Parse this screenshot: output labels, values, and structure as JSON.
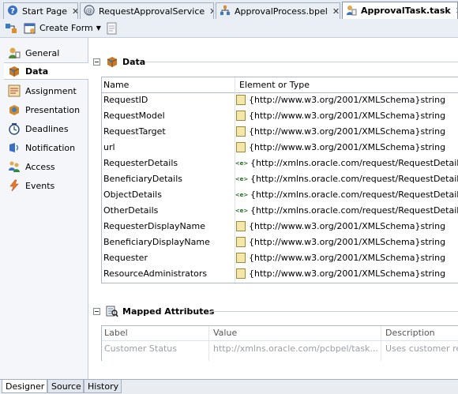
{
  "tabs": [
    {
      "label": "Start Page"
    },
    {
      "label": "RequestApprovalService"
    },
    {
      "label": "ApprovalProcess.bpel"
    },
    {
      "label": "ApprovalTask.task"
    }
  ],
  "toolbar": {
    "create_form_label": "Create Form"
  },
  "nav": [
    {
      "label": "General"
    },
    {
      "label": "Data"
    },
    {
      "label": "Assignment"
    },
    {
      "label": "Presentation"
    },
    {
      "label": "Deadlines"
    },
    {
      "label": "Notification"
    },
    {
      "label": "Access"
    },
    {
      "label": "Events"
    }
  ],
  "data_section": {
    "title": "Data",
    "columns": [
      "Name",
      "Element or Type"
    ],
    "rows": [
      {
        "name": "RequestID",
        "type": "{http://www.w3.org/2001/XMLSchema}string",
        "kind": "type"
      },
      {
        "name": "RequestModel",
        "type": "{http://www.w3.org/2001/XMLSchema}string",
        "kind": "type"
      },
      {
        "name": "RequestTarget",
        "type": "{http://www.w3.org/2001/XMLSchema}string",
        "kind": "type"
      },
      {
        "name": "url",
        "type": "{http://www.w3.org/2001/XMLSchema}string",
        "kind": "type"
      },
      {
        "name": "RequesterDetails",
        "type": "{http://xmlns.oracle.com/request/RequestDetail",
        "kind": "element"
      },
      {
        "name": "BeneficiaryDetails",
        "type": "{http://xmlns.oracle.com/request/RequestDetail",
        "kind": "element"
      },
      {
        "name": "ObjectDetails",
        "type": "{http://xmlns.oracle.com/request/RequestDetail",
        "kind": "element"
      },
      {
        "name": "OtherDetails",
        "type": "{http://xmlns.oracle.com/request/RequestDetail",
        "kind": "element"
      },
      {
        "name": "RequesterDisplayName",
        "type": "{http://www.w3.org/2001/XMLSchema}string",
        "kind": "type"
      },
      {
        "name": "BeneficiaryDisplayName",
        "type": "{http://www.w3.org/2001/XMLSchema}string",
        "kind": "type"
      },
      {
        "name": "Requester",
        "type": "{http://www.w3.org/2001/XMLSchema}string",
        "kind": "type"
      },
      {
        "name": "ResourceAdministrators",
        "type": "{http://www.w3.org/2001/XMLSchema}string",
        "kind": "type"
      }
    ]
  },
  "mapped_section": {
    "title": "Mapped Attributes",
    "columns": [
      "Label",
      "Value",
      "Description"
    ],
    "row": {
      "label": "Customer Status",
      "value": "http://xmlns.oracle.com/pcbpel/task...",
      "description": "Uses customer re"
    }
  },
  "bottom_tabs": [
    {
      "label": "Designer"
    },
    {
      "label": "Source"
    },
    {
      "label": "History"
    }
  ]
}
